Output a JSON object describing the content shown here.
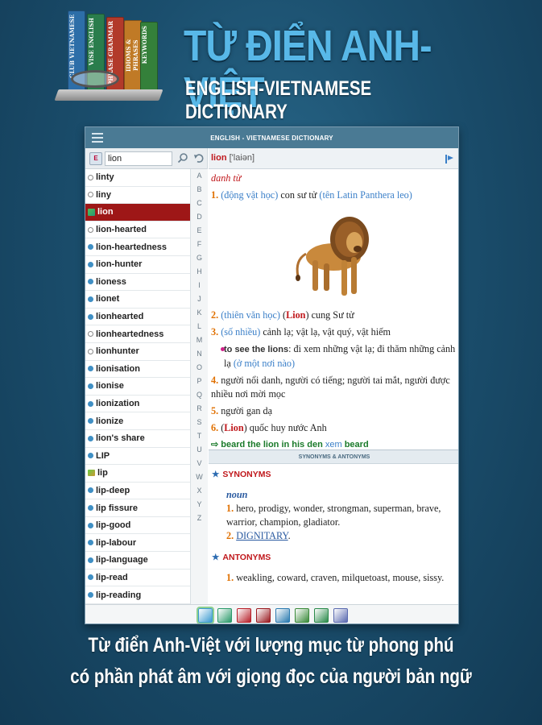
{
  "banner": {
    "title": "TỪ ĐIỂN ANH-VIỆT",
    "subtitle": "ENGLISH-VIETNAMESE DICTIONARY",
    "books": [
      "CLUB VIETNAMESE",
      "VISE ENGLISH",
      "PHRASE GRAMMAR",
      "IDIOMS & PHRASES",
      "KEYWORDS"
    ]
  },
  "appbar": {
    "title": "ENGLISH - VIETNAMESE DICTIONARY"
  },
  "search": {
    "value": "lion"
  },
  "wordlist": [
    {
      "word": "linty",
      "marker": "white"
    },
    {
      "word": "liny",
      "marker": "white"
    },
    {
      "word": "lion",
      "marker": "img",
      "selected": true
    },
    {
      "word": "lion-hearted",
      "marker": "white"
    },
    {
      "word": "lion-heartedness",
      "marker": "blue"
    },
    {
      "word": "lion-hunter",
      "marker": "blue"
    },
    {
      "word": "lioness",
      "marker": "blue"
    },
    {
      "word": "lionet",
      "marker": "blue"
    },
    {
      "word": "lionhearted",
      "marker": "blue"
    },
    {
      "word": "lionheartedness",
      "marker": "white"
    },
    {
      "word": "lionhunter",
      "marker": "white"
    },
    {
      "word": "lionisation",
      "marker": "blue"
    },
    {
      "word": "lionise",
      "marker": "blue"
    },
    {
      "word": "lionization",
      "marker": "blue"
    },
    {
      "word": "lionize",
      "marker": "blue"
    },
    {
      "word": "lion's share",
      "marker": "blue"
    },
    {
      "word": "LIP",
      "marker": "blue"
    },
    {
      "word": "lip",
      "marker": "img"
    },
    {
      "word": "lip-deep",
      "marker": "blue"
    },
    {
      "word": "lip fissure",
      "marker": "blue"
    },
    {
      "word": "lip-good",
      "marker": "blue"
    },
    {
      "word": "lip-labour",
      "marker": "blue"
    },
    {
      "word": "lip-language",
      "marker": "blue"
    },
    {
      "word": "lip-read",
      "marker": "blue"
    },
    {
      "word": "lip-reading",
      "marker": "blue"
    }
  ],
  "alphabet": [
    "A",
    "B",
    "C",
    "D",
    "E",
    "F",
    "G",
    "H",
    "I",
    "J",
    "K",
    "L",
    "M",
    "N",
    "O",
    "P",
    "Q",
    "R",
    "S",
    "T",
    "U",
    "V",
    "W",
    "X",
    "Y",
    "Z"
  ],
  "entry": {
    "headword": "lion",
    "ipa": " ['laiən]",
    "pos": "danh từ",
    "s1_num": "1.",
    "s1_field": "(động vật học)",
    "s1_text": " con sư tử ",
    "s1_latin": "(tên Latin Panthera leo)",
    "s2_num": "2.",
    "s2_field": "(thiên văn học)",
    "s2_pre": " (",
    "s2_word": "Lion",
    "s2_post": ") cung Sư tử",
    "s3_num": "3.",
    "s3_field": "(số nhiều)",
    "s3_text": " cảnh lạ; vật lạ, vật quý, vật hiếm",
    "ex_en": "to see the lions",
    "ex_vi": ": đi xem những vật lạ; đi thăm những cảnh lạ ",
    "ex_note": "(ở một nơi nào)",
    "s4_num": "4.",
    "s4_text": " người nổi danh, người có tiếng; người tai mắt, người được nhiều nơi mời mọc",
    "s5_num": "5.",
    "s5_text": " người gan dạ",
    "s6_num": "6.",
    "s6_pre": " (",
    "s6_word": "Lion",
    "s6_post": ") quốc huy nước Anh",
    "idiom": "beard the lion in his den",
    "idiom_xem": " xem ",
    "idiom_ref": "beard"
  },
  "syn_bar": "SYNONYMS & ANTONYMS",
  "synonyms": {
    "label": "SYNONYMS",
    "pos": "noun",
    "n1": "1.",
    "list1": " hero, prodigy, wonder, strongman, superman, brave, warrior, champion, gladiator.",
    "n2": "2.",
    "link": "DIGNITARY",
    "end": "."
  },
  "antonyms": {
    "label": "ANTONYMS",
    "n1": "1.",
    "list1": " weakling, coward, craven, milquetoast, mouse, sissy."
  },
  "toolbar": [
    {
      "name": "ev-dictionary",
      "color": "#3a9ad0"
    },
    {
      "name": "ve-dictionary",
      "color": "#2a9a6a"
    },
    {
      "name": "ee-dictionary",
      "color": "#b8202a"
    },
    {
      "name": "thesaurus",
      "color": "#9a1a20"
    },
    {
      "name": "search-tool",
      "color": "#2a7ab0"
    },
    {
      "name": "translate",
      "color": "#3a8a3a"
    },
    {
      "name": "grammar",
      "color": "#2a8a4a"
    },
    {
      "name": "settings",
      "color": "#5a6ab0"
    }
  ],
  "captions": {
    "line1": "Từ điển Anh-Việt với lượng mục từ phong phú",
    "line2": "có phần phát âm với giọng đọc của người bản ngữ"
  },
  "colors": {
    "accent": "#c0181c",
    "appbar": "#4a7a94",
    "selected": "#9e1717"
  }
}
